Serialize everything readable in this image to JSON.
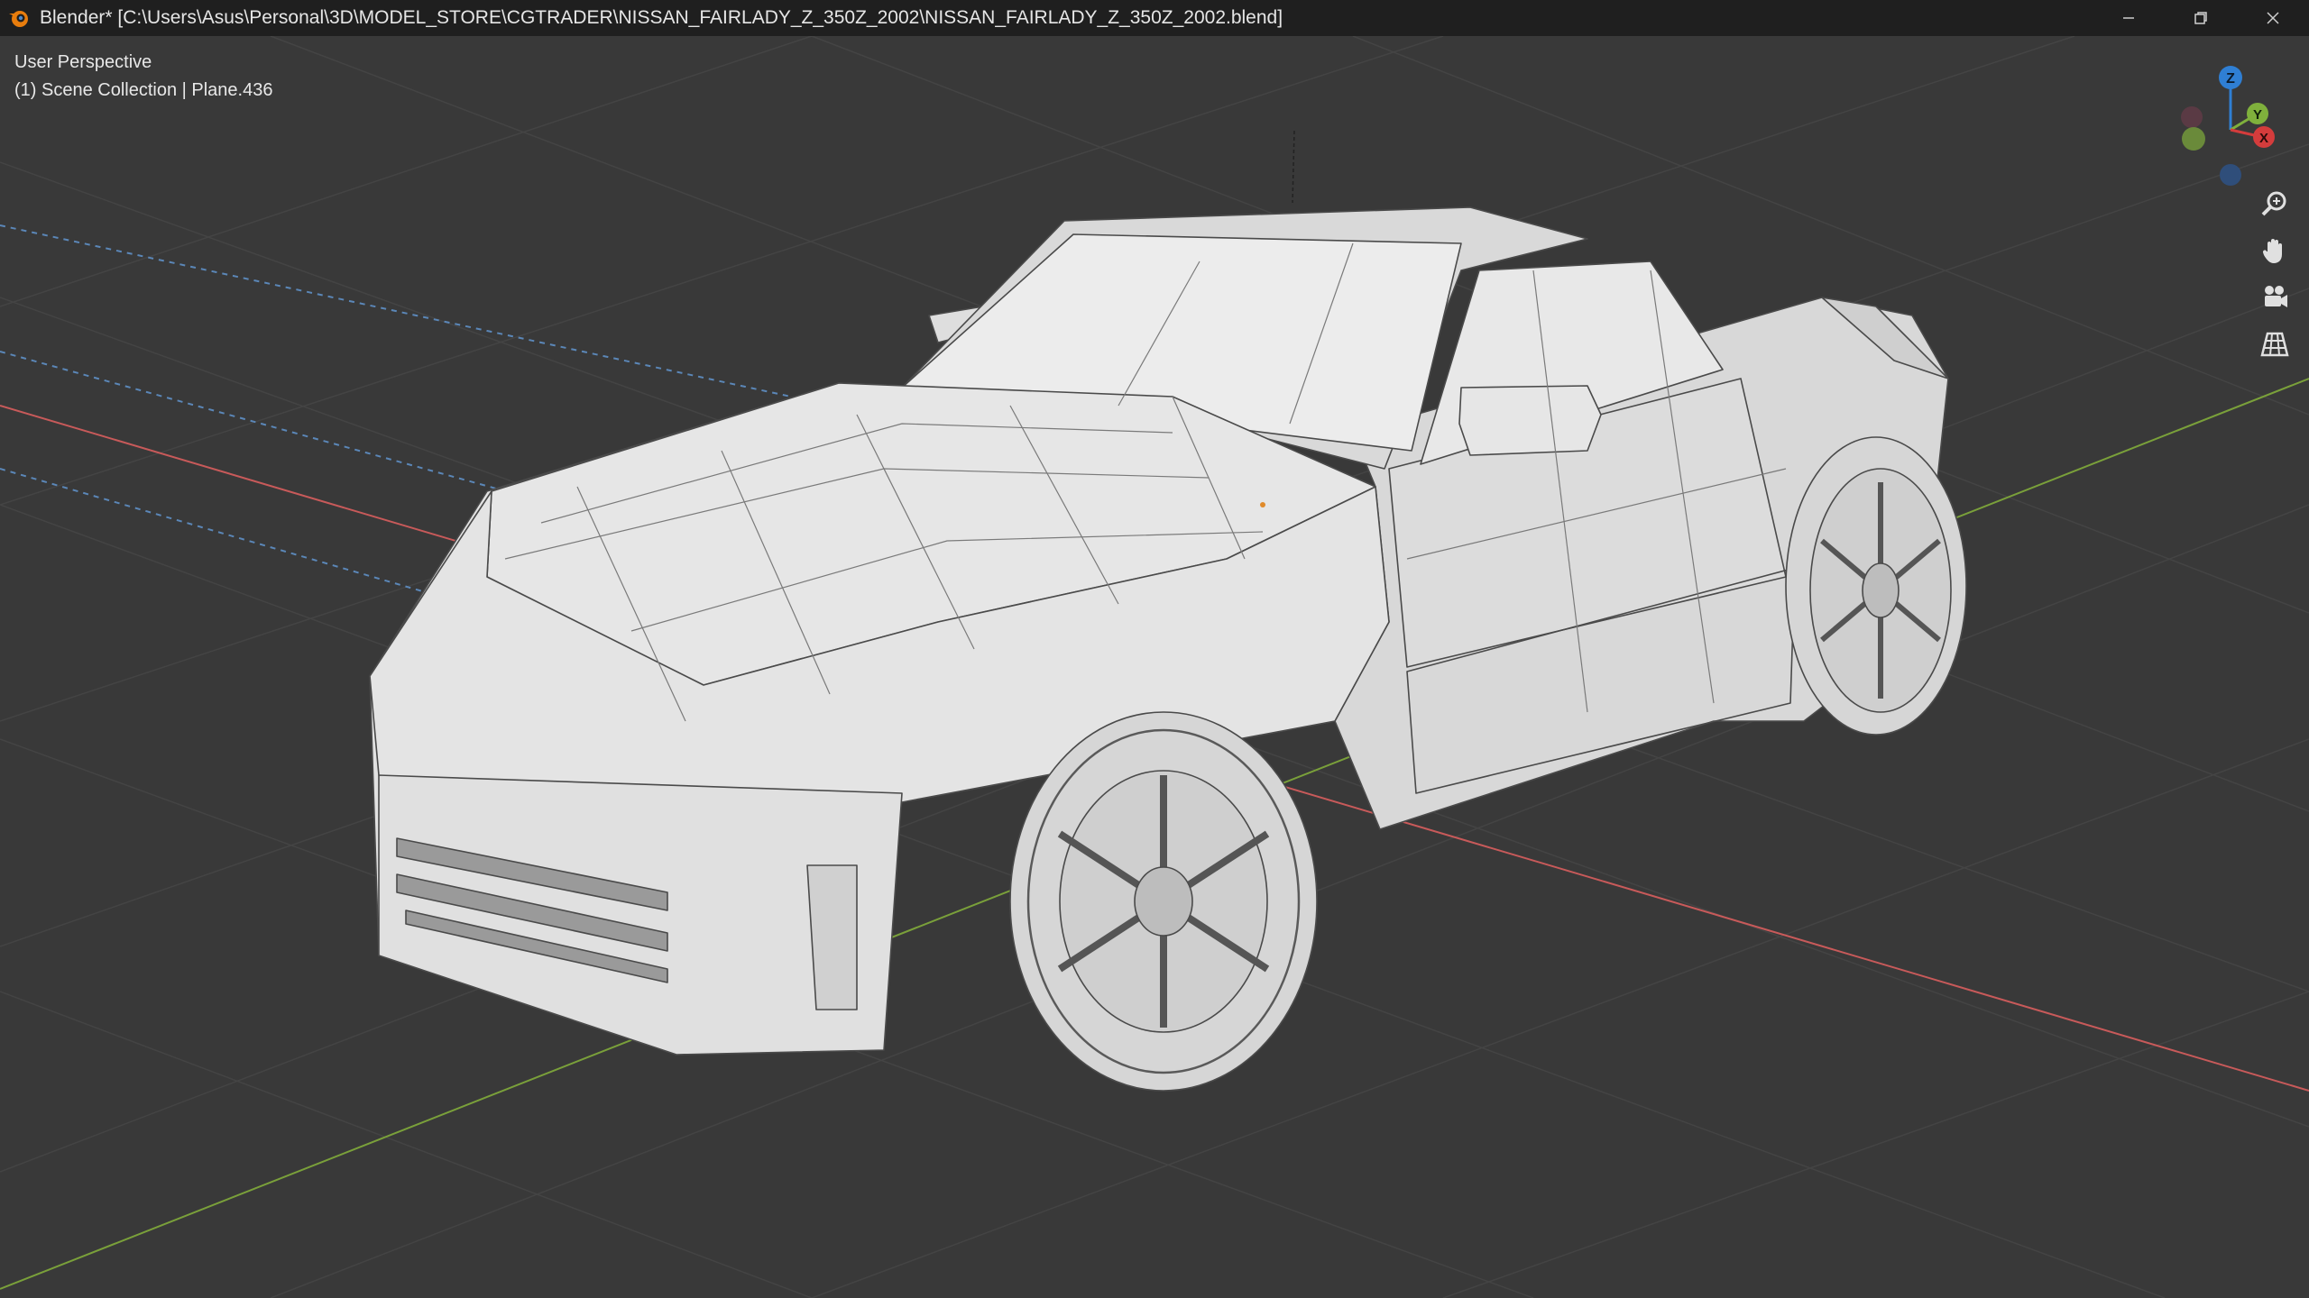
{
  "window": {
    "title": "Blender* [C:\\Users\\Asus\\Personal\\3D\\MODEL_STORE\\CGTRADER\\NISSAN_FAIRLADY_Z_350Z_2002\\NISSAN_FAIRLADY_Z_350Z_2002.blend]",
    "app_icon": "blender-logo-icon",
    "controls": [
      "minimize-icon",
      "restore-icon",
      "close-icon"
    ]
  },
  "viewport": {
    "view_name": "User Perspective",
    "collection_info": "(1) Scene Collection | Plane.436",
    "background_color": "#393939",
    "grid_color": "#444444",
    "x_axis_color": "#c85a5a",
    "y_axis_color": "#7aa03a",
    "model_color": "#e4e4e4",
    "wire_color": "#4a4a4a"
  },
  "gizmo": {
    "z_label": "Z",
    "y_label": "Y",
    "x_label": "X",
    "z_color": "#2f7fd4",
    "y_color": "#7fb03c",
    "x_color": "#d43c3c"
  },
  "nav_tools": [
    "zoom-icon",
    "pan-hand-icon",
    "camera-view-icon",
    "ortho-grid-icon"
  ]
}
